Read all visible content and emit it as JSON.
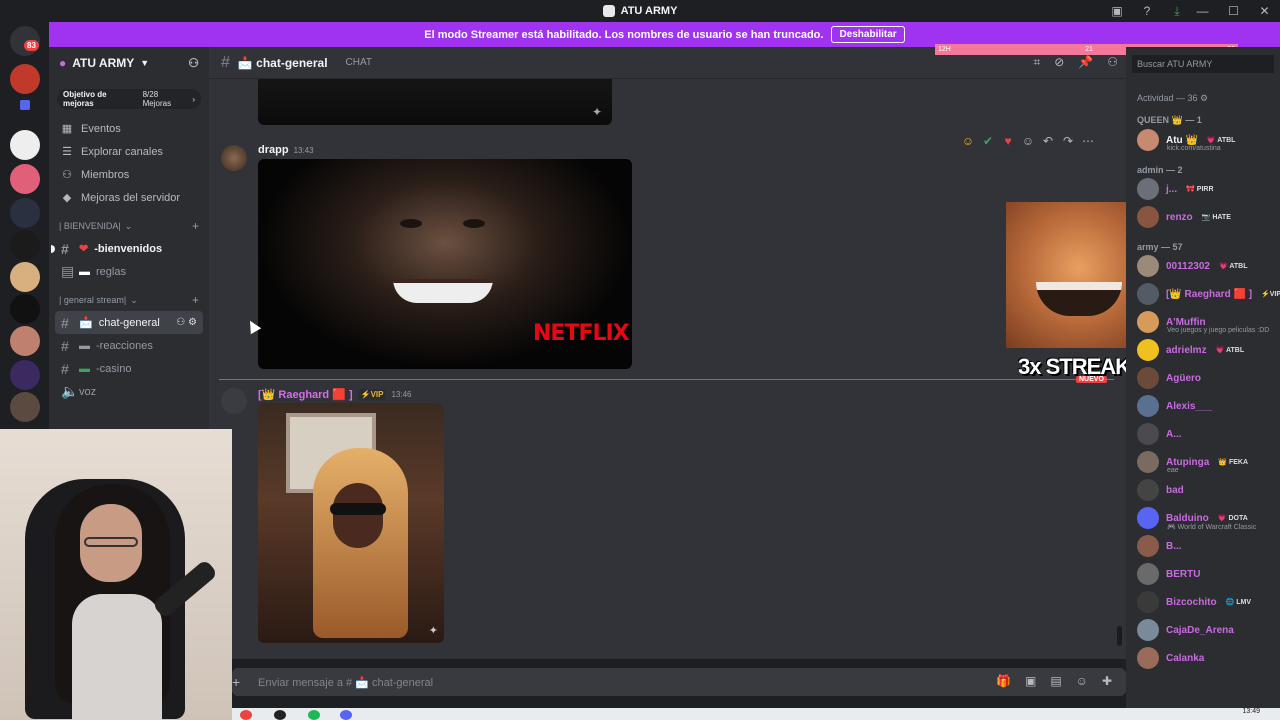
{
  "window": {
    "title": "ATU ARMY",
    "controls": [
      "—",
      "☐",
      "✕"
    ]
  },
  "rail": {
    "badge": "83"
  },
  "banner": {
    "message": "El modo Streamer está habilitado. Los nombres de usuario se han truncado.",
    "button": "Deshabilitar"
  },
  "streak_bar": {
    "left": "12H",
    "mid": "21",
    "right": "20"
  },
  "guild": {
    "name": "ATU ARMY",
    "boost_label": "Objetivo de mejoras",
    "boost_count": "8/28 Mejoras"
  },
  "nav": [
    {
      "icon": "calendar-icon",
      "label": "Eventos"
    },
    {
      "icon": "compass-icon",
      "label": "Explorar canales"
    },
    {
      "icon": "members-icon",
      "label": "Miembros"
    },
    {
      "icon": "boost-icon",
      "label": "Mejoras del servidor"
    }
  ],
  "categories": [
    {
      "name": "| BIENVENIDA|",
      "channels": [
        {
          "prefix": "❤",
          "name": "-bienvenidos"
        },
        {
          "prefix": "▬",
          "name": "reglas"
        }
      ]
    },
    {
      "name": "| general stream|",
      "channels": [
        {
          "prefix": "📩",
          "name": "chat-general"
        },
        {
          "prefix": "▬",
          "name": "-reacciones"
        },
        {
          "prefix": "▬",
          "name": "-casino"
        },
        {
          "prefix": "",
          "name": "voz"
        }
      ]
    }
  ],
  "chat": {
    "channel": "📩 chat-general",
    "topic": "CHAT",
    "composer_placeholder": "Enviar mensaje a # 📩 chat-general"
  },
  "messages": [
    {
      "author": "drapp",
      "time": "13:43",
      "image_text": "NETFLIX"
    },
    {
      "author": "[👑 Raeghard 🟥 ]",
      "tag": "⚡VIP",
      "time": "13:46"
    }
  ],
  "streak": {
    "text": "3x STREAK",
    "badge": "NUEVO"
  },
  "members": {
    "search_placeholder": "Buscar ATU ARMY",
    "activity": "Actividad — 36",
    "groups": [
      {
        "role": "QUEEN 👑 — 1",
        "items": [
          {
            "name": "Atu 👑",
            "tag": "💗 ATBL",
            "sub": "kick.com/atustina",
            "color": "#f2f3f5",
            "avatar": "#c68a70"
          }
        ]
      },
      {
        "role": "admin — 2",
        "items": [
          {
            "name": "j...",
            "tag": "🎀 PIRR",
            "color": "#c96be0",
            "avatar": "#6b6f78"
          },
          {
            "name": "renzo",
            "tag": "📷 HATE",
            "color": "#c96be0",
            "avatar": "#8a5540"
          }
        ]
      },
      {
        "role": "army — 57",
        "items": [
          {
            "name": "00112302",
            "tag": "💗 ATBL",
            "color": "#c96be0",
            "avatar": "#9b8a7a"
          },
          {
            "name": "[👑 Raeghard 🟥 ]",
            "tag": "⚡VIP",
            "color": "#c96be0",
            "avatar": "#555b64"
          },
          {
            "name": "A'Muffin",
            "sub": "Veo juegos y juego peliculas :DD",
            "color": "#c96be0",
            "avatar": "#d69a5a"
          },
          {
            "name": "adrielmz",
            "tag": "💗 ATBL",
            "color": "#c96be0",
            "avatar": "#f0c020"
          },
          {
            "name": "Agüero",
            "color": "#c96be0",
            "avatar": "#6b4a3a"
          },
          {
            "name": "Alexis___",
            "color": "#c96be0",
            "avatar": "#5a7090"
          },
          {
            "name": "A...",
            "color": "#c96be0",
            "avatar": "#4a4a50"
          },
          {
            "name": "Atupinga",
            "tag": "👑 FEKA",
            "sub": "eae",
            "color": "#c96be0",
            "avatar": "#7a6a60"
          },
          {
            "name": "bad",
            "color": "#c96be0",
            "avatar": "#444"
          },
          {
            "name": "Balduino",
            "tag": "💗 DOTA",
            "sub": "🎮 World of Warcraft Classic",
            "color": "#c96be0",
            "avatar": "#5865f2"
          },
          {
            "name": "B...",
            "color": "#c96be0",
            "avatar": "#8a5a4a"
          },
          {
            "name": "BERTU",
            "color": "#c96be0",
            "avatar": "#6a6a6a"
          },
          {
            "name": "Bizcochito",
            "tag": "🌐 LMV",
            "color": "#c96be0",
            "avatar": "#3a3a3a"
          },
          {
            "name": "CajaDe_Arena",
            "color": "#c96be0",
            "avatar": "#7a8a9a"
          },
          {
            "name": "Calanka",
            "color": "#c96be0",
            "avatar": "#9a6a5a"
          }
        ]
      }
    ]
  },
  "taskbar": {
    "clock": "13:49"
  }
}
